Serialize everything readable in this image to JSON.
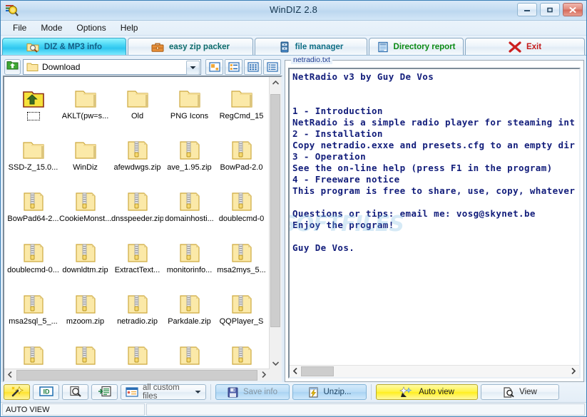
{
  "window": {
    "title": "WinDIZ 2.8",
    "icon": "windiz-app-icon",
    "minimize_label": "–",
    "maximize_label": "▭",
    "close_label": "✕"
  },
  "menubar": {
    "items": [
      {
        "label": "File",
        "name": "menu-file"
      },
      {
        "label": "Mode",
        "name": "menu-mode"
      },
      {
        "label": "Options",
        "name": "menu-options"
      },
      {
        "label": "Help",
        "name": "menu-help"
      }
    ]
  },
  "tabs": [
    {
      "label": "DIZ & MP3 info",
      "icon": "folder-magnifier-icon",
      "active": true
    },
    {
      "label": "easy zip packer",
      "icon": "briefcase-icon",
      "active": false
    },
    {
      "label": "file manager",
      "icon": "file-cabinet-icon",
      "active": false
    },
    {
      "label": "Directory report",
      "icon": "report-document-icon",
      "active": false
    },
    {
      "label": "Exit",
      "icon": "red-x-icon",
      "active": false
    }
  ],
  "pathbar": {
    "up_icon": "up-folder-green-icon",
    "current_folder": "Download",
    "folder_icon": "folder-icon",
    "dropdown_icon": "chevron-down-icon",
    "view_buttons": [
      {
        "name": "view-large-icons",
        "icon": "large-icons-icon"
      },
      {
        "name": "view-small-icons",
        "icon": "small-icons-icon"
      },
      {
        "name": "view-list",
        "icon": "list-icon"
      },
      {
        "name": "view-details",
        "icon": "details-icon"
      }
    ]
  },
  "filelist": {
    "items": [
      {
        "label": "",
        "type": "up",
        "focused": true
      },
      {
        "label": "AKLT(pw=s...",
        "type": "folder"
      },
      {
        "label": "Old",
        "type": "folder"
      },
      {
        "label": "PNG Icons",
        "type": "folder"
      },
      {
        "label": "RegCmd_15",
        "type": "folder"
      },
      {
        "label": "SSD-Z_15.0...",
        "type": "folder"
      },
      {
        "label": "WinDiz",
        "type": "folder"
      },
      {
        "label": "afewdwgs.zip",
        "type": "zip"
      },
      {
        "label": "ave_1.95.zip",
        "type": "zip"
      },
      {
        "label": "BowPad-2.0",
        "type": "zip"
      },
      {
        "label": "BowPad64-2...",
        "type": "zip"
      },
      {
        "label": "CookieMonst...",
        "type": "zip"
      },
      {
        "label": "dnsspeeder.zip",
        "type": "zip"
      },
      {
        "label": "domainhosti...",
        "type": "zip"
      },
      {
        "label": "doublecmd-0",
        "type": "zip"
      },
      {
        "label": "doublecmd-0...",
        "type": "zip"
      },
      {
        "label": "downldtm.zip",
        "type": "zip"
      },
      {
        "label": "ExtractText...",
        "type": "zip"
      },
      {
        "label": "monitorinfo...",
        "type": "zip"
      },
      {
        "label": "msa2mys_5...",
        "type": "zip"
      },
      {
        "label": "msa2sql_5_...",
        "type": "zip"
      },
      {
        "label": "mzoom.zip",
        "type": "zip"
      },
      {
        "label": "netradio.zip",
        "type": "zip"
      },
      {
        "label": "Parkdale.zip",
        "type": "zip"
      },
      {
        "label": "QQPlayer_S",
        "type": "zip"
      },
      {
        "label": "",
        "type": "zip"
      },
      {
        "label": "",
        "type": "zip"
      },
      {
        "label": "",
        "type": "zip"
      },
      {
        "label": "",
        "type": "zip"
      },
      {
        "label": "",
        "type": "zip"
      }
    ],
    "scroll_up_icon": "chevron-up-icon",
    "scroll_down_icon": "chevron-down-icon",
    "scroll_left_icon": "chevron-left-icon",
    "scroll_right_icon": "chevron-right-icon"
  },
  "viewer": {
    "title": "netradio.txt",
    "text_color": "#111c7a",
    "lines": [
      "NetRadio v3 by Guy De Vos",
      "",
      "",
      "1 - Introduction",
      "NetRadio is a simple radio player for steaming int",
      "2 - Installation",
      "Copy netradio.exxe and presets.cfg to an empty dir",
      "3 - Operation",
      "See the on-line help (press F1 in the program)",
      "4 - Freeware notice",
      "This program is free to share, use, copy, whatever",
      "",
      "Questions or tips: email me: vosg@skynet.be",
      "Enjoy the program!",
      "",
      "Guy De Vos."
    ],
    "scroll_left_icon": "chevron-left-icon",
    "scroll_right_icon": "chevron-right-icon"
  },
  "watermark": "SOFTFILES",
  "bottombar": {
    "buttons": [
      {
        "label": "",
        "name": "auto-wand-button",
        "icon": "magic-wand-icon",
        "style": "wand"
      },
      {
        "label": "",
        "name": "id-button",
        "icon": "id-tag-icon",
        "style": "sq"
      },
      {
        "label": "",
        "name": "inspect-button",
        "icon": "magnifier-document-icon",
        "style": "sq"
      },
      {
        "label": "",
        "name": "description-button",
        "icon": "document-arrow-icon",
        "style": "sq"
      }
    ],
    "filter": {
      "label": "all custom files",
      "icon": "filter-window-icon",
      "arrow": "chevron-down-icon"
    },
    "save_info": {
      "label": "Save info",
      "icon": "floppy-disk-icon",
      "disabled": true
    },
    "unzip": {
      "label": "Unzip...",
      "icon": "unzip-lightning-icon"
    },
    "auto_view": {
      "label": "Auto view",
      "icon": "magic-wand-icon",
      "active": true
    },
    "view": {
      "label": "View",
      "icon": "magnifier-page-icon"
    }
  },
  "statusbar": {
    "left": "AUTO VIEW",
    "right": ""
  }
}
